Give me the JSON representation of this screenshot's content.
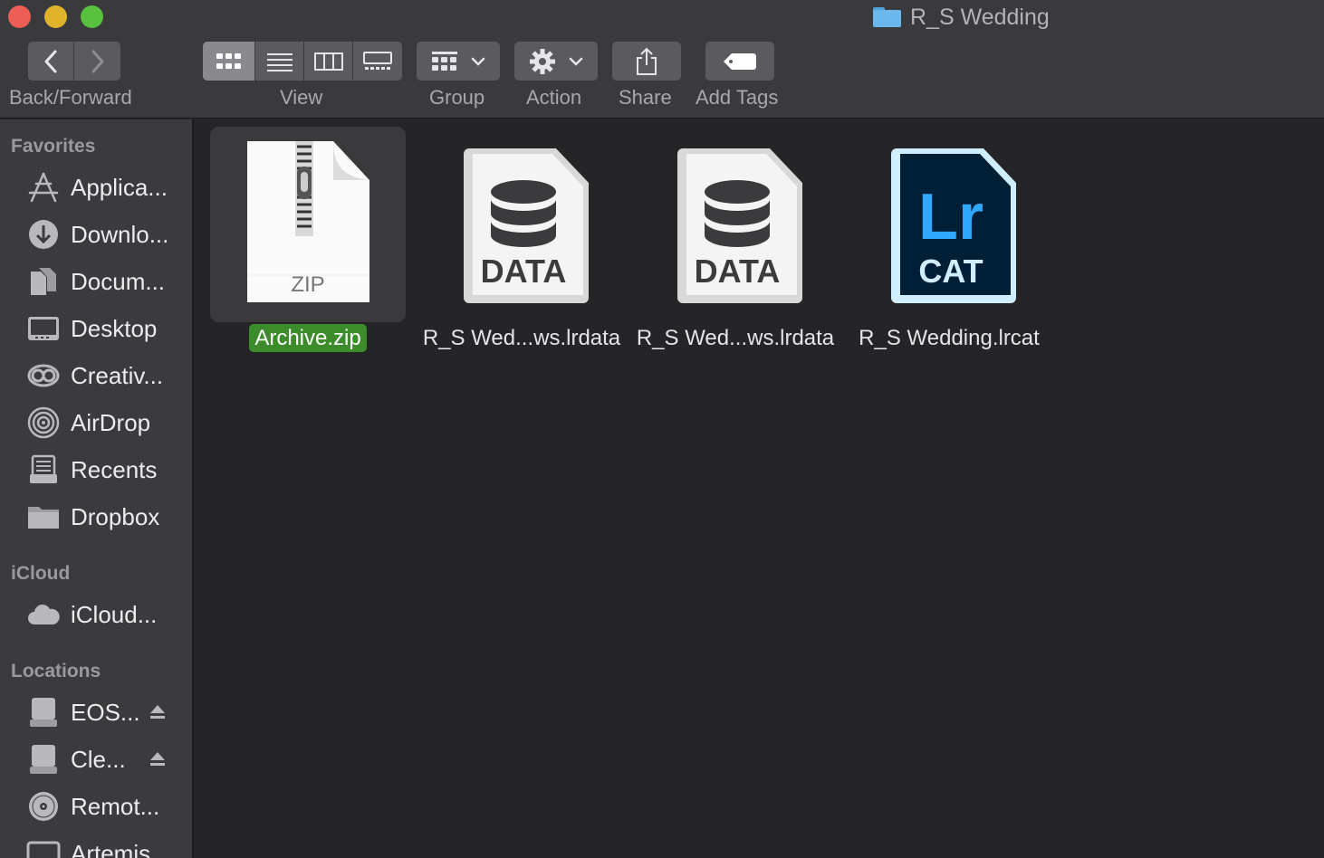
{
  "window": {
    "title": "R_S Wedding"
  },
  "toolbar": {
    "back_forward_label": "Back/Forward",
    "view_label": "View",
    "group_label": "Group",
    "action_label": "Action",
    "share_label": "Share",
    "add_tags_label": "Add Tags"
  },
  "sidebar": {
    "favorites": {
      "heading": "Favorites",
      "items": [
        {
          "label": "Applica...",
          "icon": "applications-icon"
        },
        {
          "label": "Downlo...",
          "icon": "downloads-icon"
        },
        {
          "label": "Docum...",
          "icon": "documents-icon"
        },
        {
          "label": "Desktop",
          "icon": "desktop-icon"
        },
        {
          "label": "Creativ...",
          "icon": "creative-cloud-icon"
        },
        {
          "label": "AirDrop",
          "icon": "airdrop-icon"
        },
        {
          "label": "Recents",
          "icon": "recents-icon"
        },
        {
          "label": "Dropbox",
          "icon": "folder-icon"
        }
      ]
    },
    "icloud": {
      "heading": "iCloud",
      "items": [
        {
          "label": "iCloud...",
          "icon": "cloud-icon"
        }
      ]
    },
    "locations": {
      "heading": "Locations",
      "items": [
        {
          "label": "EOS...",
          "icon": "drive-icon",
          "ejectable": true
        },
        {
          "label": "Cle...",
          "icon": "drive-icon",
          "ejectable": true
        },
        {
          "label": "Remot...",
          "icon": "disc-icon"
        },
        {
          "label": "Artemis",
          "icon": "computer-icon"
        }
      ]
    }
  },
  "files": [
    {
      "name": "Archive.zip",
      "icon_text": "ZIP",
      "kind": "zip",
      "selected": true
    },
    {
      "name": "R_S Wed...ws.lrdata",
      "icon_text": "DATA",
      "kind": "data",
      "selected": false
    },
    {
      "name": "R_S Wed...ws.lrdata",
      "icon_text": "DATA",
      "kind": "data",
      "selected": false
    },
    {
      "name": "R_S Wedding.lrcat",
      "icon_text": "CAT",
      "icon_logo": "Lr",
      "kind": "lrcat",
      "selected": false
    }
  ],
  "colors": {
    "selection_green": "#3c8c2c",
    "lightroom_bg": "#001e36",
    "lightroom_accent": "#31a8ff"
  }
}
